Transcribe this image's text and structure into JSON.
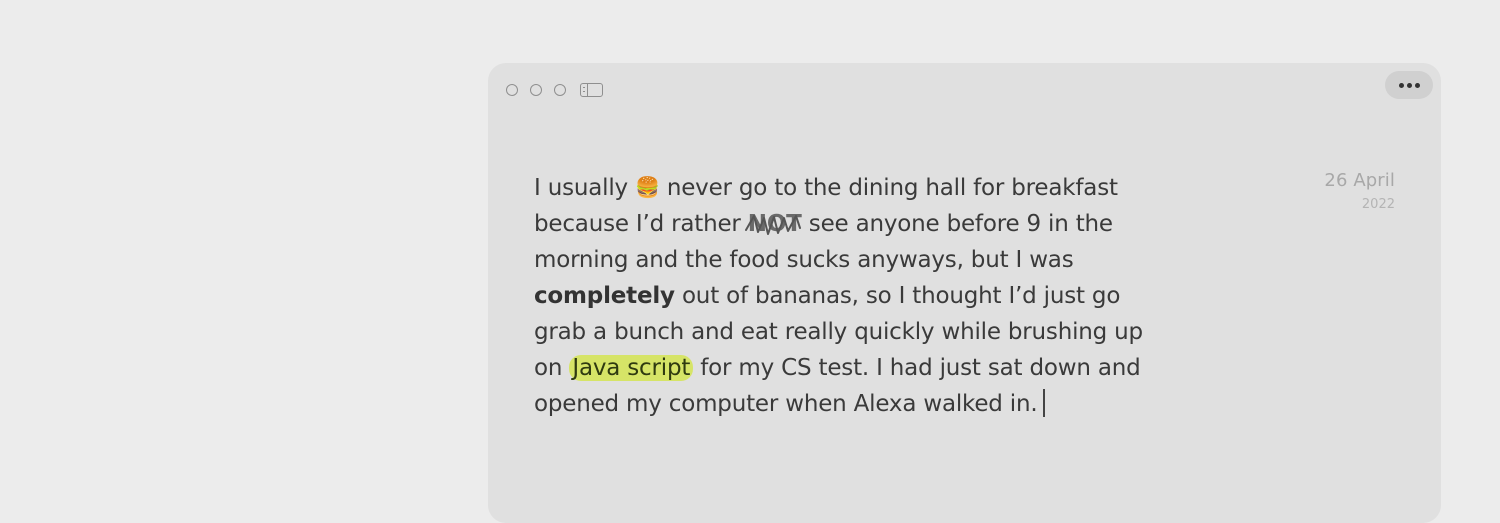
{
  "window": {
    "traffic_lights": [
      "close",
      "minimize",
      "zoom"
    ],
    "toolbar": {
      "sidebar_icon": "sidebar-icon",
      "more_icon": "more-horizontal-icon"
    }
  },
  "date": {
    "day": "26 April",
    "year": "2022"
  },
  "note": {
    "emoji": "🍔",
    "p1": "I usually ",
    "p2": " never go to the dining hall for breakfast because I’d rather ",
    "scribble_word": "NOT",
    "p3": " see anyone before 9 in the morning and the food sucks anyways, but I was ",
    "bold": "completely",
    "p4": " out of bananas, so I thought I’d just go grab a bunch and eat really quickly while brushing up on ",
    "highlight": "Java script",
    "p5": " for my CS test. I had just sat down and opened my computer when Alexa walked in."
  }
}
